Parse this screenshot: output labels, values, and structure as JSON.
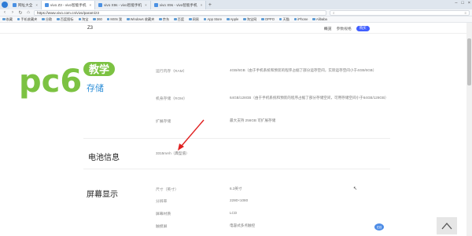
{
  "browser": {
    "tabs": [
      {
        "label": "网址大全",
        "active": false
      },
      {
        "label": "vivo Z3 - vivo智能手机",
        "active": true
      },
      {
        "label": "vivo X9s - vivo智能手机",
        "active": false
      },
      {
        "label": "vivo X9s - vivo智能手机",
        "active": false
      }
    ],
    "url": "https://www.vivo.com.cn/vivo/param/z3",
    "bookmarks": [
      "收藏",
      "手机收藏夹",
      "谷歌",
      "百度图标",
      "淘宝",
      "360",
      "MSN 我",
      "Windows 收藏夹",
      "京东",
      "百度",
      "网易",
      "App Store",
      "Apple",
      "淘宝网",
      "OPPO",
      "天猫",
      "iPhone",
      "Alibaba"
    ]
  },
  "subnav": {
    "model": "Z3",
    "links": [
      "概览",
      "参数规格"
    ],
    "buy_label": "购买"
  },
  "sections": [
    {
      "title": "存储",
      "rows": [
        {
          "label": "运行内存（RAM）",
          "value": "4GB/6GB（由于手机系统和预装的程序占据了部分运存空间，实际运存空间小于4GB/6GB）"
        },
        {
          "label": "机身存储（ROM）",
          "value": "64GB/128GB（由于手机系统和预装的程序占据了部分存储空间，可用存储空间小于64GB/128GB）"
        },
        {
          "label": "扩展存储",
          "value": "最大支持 256GB 可扩展存储"
        }
      ]
    },
    {
      "title": "电池信息",
      "rows": [
        {
          "label": "",
          "value": "3315mAh（典型值）"
        }
      ]
    },
    {
      "title": "屏幕显示",
      "rows": [
        {
          "label": "尺寸（英寸）",
          "value": "6.3英寸"
        },
        {
          "label": "分辨率",
          "value": "2280×1080"
        },
        {
          "label": "屏幕材质",
          "value": "LCD"
        },
        {
          "label": "触摸屏",
          "value": "电容式多点触控"
        }
      ]
    }
  ],
  "watermark": {
    "brand": "pc6",
    "tag1": "教学",
    "tag2": "存储"
  },
  "chat_label": "在线",
  "colors": {
    "buy": "#415fff",
    "logo_green": "#7cc242",
    "logo_blue": "#2f8fd8"
  }
}
